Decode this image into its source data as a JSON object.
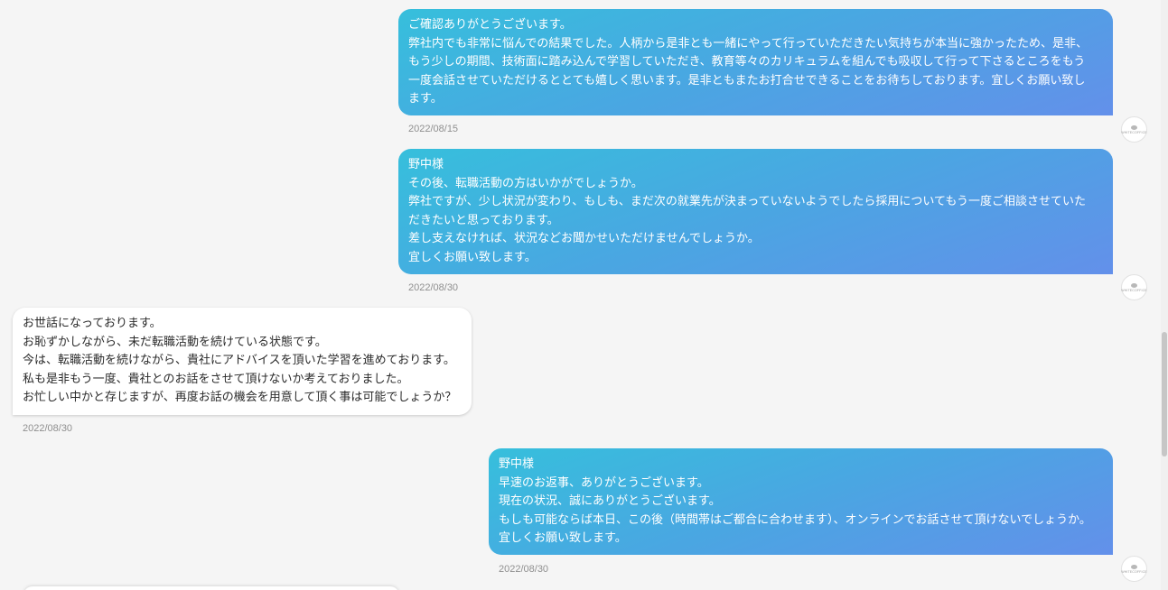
{
  "messages": [
    {
      "direction": "outgoing",
      "lines": [
        "ご確認ありがとうございます。",
        "弊社内でも非常に悩んでの結果でした。人柄から是非とも一緒にやって行っていただきたい気持ちが本当に強かったため、是非、",
        "もう少しの期間、技術面に踏み込んで学習していただき、教育等々のカリキュラムを組んでも吸収して行って下さるところをもう",
        "一度会話させていただけるととても嬉しく思います。是非ともまたお打合せできることをお待ちしております。宜しくお願い致し",
        "ます。"
      ],
      "timestamp": "2022/08/15",
      "avatar_text": "WHITECOFFICE"
    },
    {
      "direction": "outgoing",
      "lines": [
        "野中様",
        "その後、転職活動の方はいかがでしょうか。",
        "弊社ですが、少し状況が変わり、もしも、まだ次の就業先が決まっていないようでしたら採用についてもう一度ご相談させていた",
        "だきたいと思っております。",
        "差し支えなければ、状況などお聞かせいただけませんでしょうか。",
        "宜しくお願い致します。"
      ],
      "timestamp": "2022/08/30",
      "avatar_text": "WHITECOFFICE"
    },
    {
      "direction": "incoming",
      "lines": [
        "お世話になっております。",
        "お恥ずかしながら、未だ転職活動を続けている状態です。",
        "今は、転職活動を続けながら、貴社にアドバイスを頂いた学習を進めております。",
        "私も是非もう一度、貴社とのお話をさせて頂けないか考えておりました。",
        "お忙しい中かと存じますが、再度お話の機会を用意して頂く事は可能でしょうか？"
      ],
      "timestamp": "2022/08/30"
    },
    {
      "direction": "outgoing",
      "lines": [
        "野中様",
        "早速のお返事、ありがとうございます。",
        "現在の状況、誠にありがとうございます。",
        "もしも可能ならば本日、この後（時間帯はご都合に合わせます）、オンラインでお話させて頂けないでしょうか。",
        "宜しくお願い致します。"
      ],
      "timestamp": "2022/08/30",
      "avatar_text": "WHITECOFFICE"
    }
  ],
  "colors": {
    "background": "#f5f5f5",
    "outgoing_gradient_start": "#36bfdc",
    "outgoing_gradient_end": "#6390ea",
    "incoming_bubble": "#ffffff",
    "timestamp_text": "#8f8f8f"
  }
}
